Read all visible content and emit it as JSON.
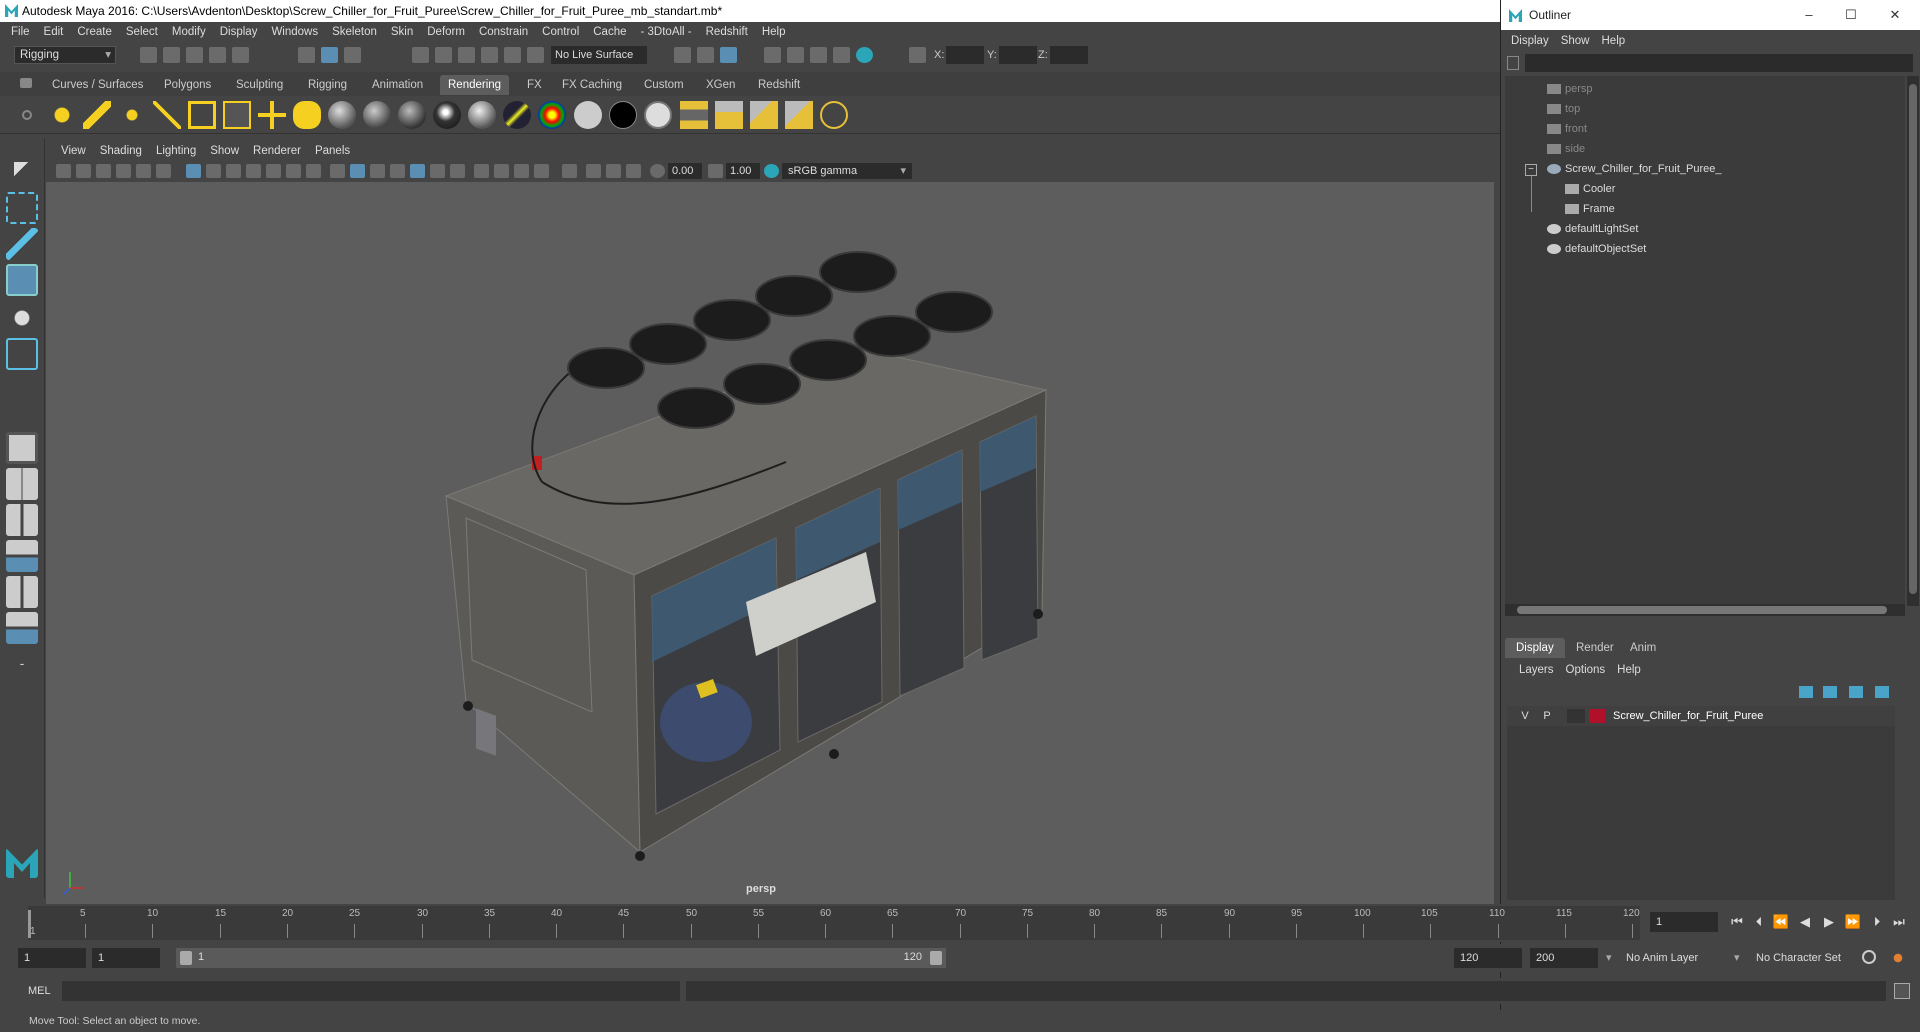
{
  "title_bar": {
    "text": "Autodesk Maya 2016: C:\\Users\\Avdenton\\Desktop\\Screw_Chiller_for_Fruit_Puree\\Screw_Chiller_for_Fruit_Puree_mb_standart.mb*"
  },
  "main_menu": [
    "File",
    "Edit",
    "Create",
    "Select",
    "Modify",
    "Display",
    "Windows",
    "Skeleton",
    "Skin",
    "Deform",
    "Constrain",
    "Control",
    "Cache",
    "- 3DtoAll -",
    "Redshift",
    "Help"
  ],
  "toolbar": {
    "mode": "Rigging",
    "live_surface": "No Live Surface",
    "x_label": "X:",
    "y_label": "Y:",
    "z_label": "Z:"
  },
  "shelf_tabs": [
    "Curves / Surfaces",
    "Polygons",
    "Sculpting",
    "Rigging",
    "Animation",
    "Rendering",
    "FX",
    "FX Caching",
    "Custom",
    "XGen",
    "Redshift"
  ],
  "active_shelf_tab": "Rendering",
  "viewport": {
    "menu": [
      "View",
      "Shading",
      "Lighting",
      "Show",
      "Renderer",
      "Panels"
    ],
    "exposure": "0.00",
    "gamma": "1.00",
    "color_space": "sRGB gamma",
    "camera_label": "persp"
  },
  "outliner": {
    "title": "Outliner",
    "menu": [
      "Display",
      "Show",
      "Help"
    ],
    "items": [
      {
        "label": "persp",
        "dim": true
      },
      {
        "label": "top",
        "dim": true
      },
      {
        "label": "front",
        "dim": true
      },
      {
        "label": "side",
        "dim": true
      },
      {
        "label": "Screw_Chiller_for_Fruit_Puree_",
        "dim": false
      },
      {
        "label": "Cooler",
        "dim": false
      },
      {
        "label": "Frame",
        "dim": false
      },
      {
        "label": "defaultLightSet",
        "dim": false
      },
      {
        "label": "defaultObjectSet",
        "dim": false
      }
    ]
  },
  "layer_editor": {
    "tabs": [
      "Display",
      "Render",
      "Anim"
    ],
    "active_tab": "Display",
    "menu": [
      "Layers",
      "Options",
      "Help"
    ],
    "layer": {
      "v": "V",
      "p": "P",
      "name": "Screw_Chiller_for_Fruit_Puree",
      "color": "#b0102a"
    }
  },
  "time_slider": {
    "ticks": [
      "5",
      "10",
      "15",
      "20",
      "25",
      "30",
      "35",
      "40",
      "45",
      "50",
      "55",
      "60",
      "65",
      "70",
      "75",
      "80",
      "85",
      "90",
      "95",
      "100",
      "105",
      "110",
      "115",
      "120"
    ],
    "start_tick": "1",
    "current_frame": "1"
  },
  "range_slider": {
    "start": "1",
    "anim_start": "1",
    "range_start_label": "1",
    "range_end_label": "120",
    "anim_end": "120",
    "end": "200",
    "anim_layer": "No Anim Layer",
    "character_set": "No Character Set"
  },
  "command_line": {
    "label": "MEL"
  },
  "help_line": "Move Tool: Select an object to move."
}
